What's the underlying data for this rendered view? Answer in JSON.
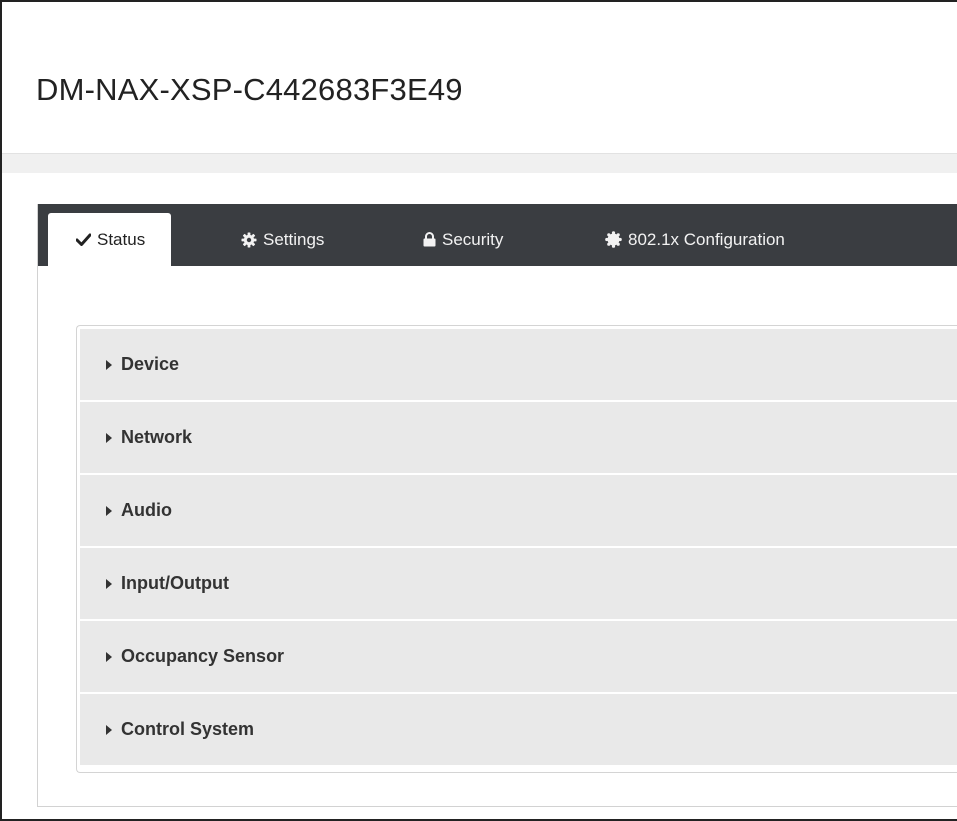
{
  "header": {
    "device_name": "DM-NAX-XSP-C442683F3E49"
  },
  "tabs": [
    {
      "label": "Status",
      "icon": "check-icon",
      "active": true
    },
    {
      "label": "Settings",
      "icon": "gear-icon",
      "active": false
    },
    {
      "label": "Security",
      "icon": "lock-icon",
      "active": false
    },
    {
      "label": "802.1x Configuration",
      "icon": "badge-icon",
      "active": false
    }
  ],
  "accordion": {
    "sections": [
      {
        "label": "Device",
        "expanded": false
      },
      {
        "label": "Network",
        "expanded": false
      },
      {
        "label": "Audio",
        "expanded": false
      },
      {
        "label": "Input/Output",
        "expanded": false
      },
      {
        "label": "Occupancy Sensor",
        "expanded": false
      },
      {
        "label": "Control System",
        "expanded": false
      }
    ]
  },
  "colors": {
    "tabbar_bg": "#3a3d41",
    "section_bg": "#e9e9e9",
    "header_rule_bg": "#f0f0f0"
  }
}
